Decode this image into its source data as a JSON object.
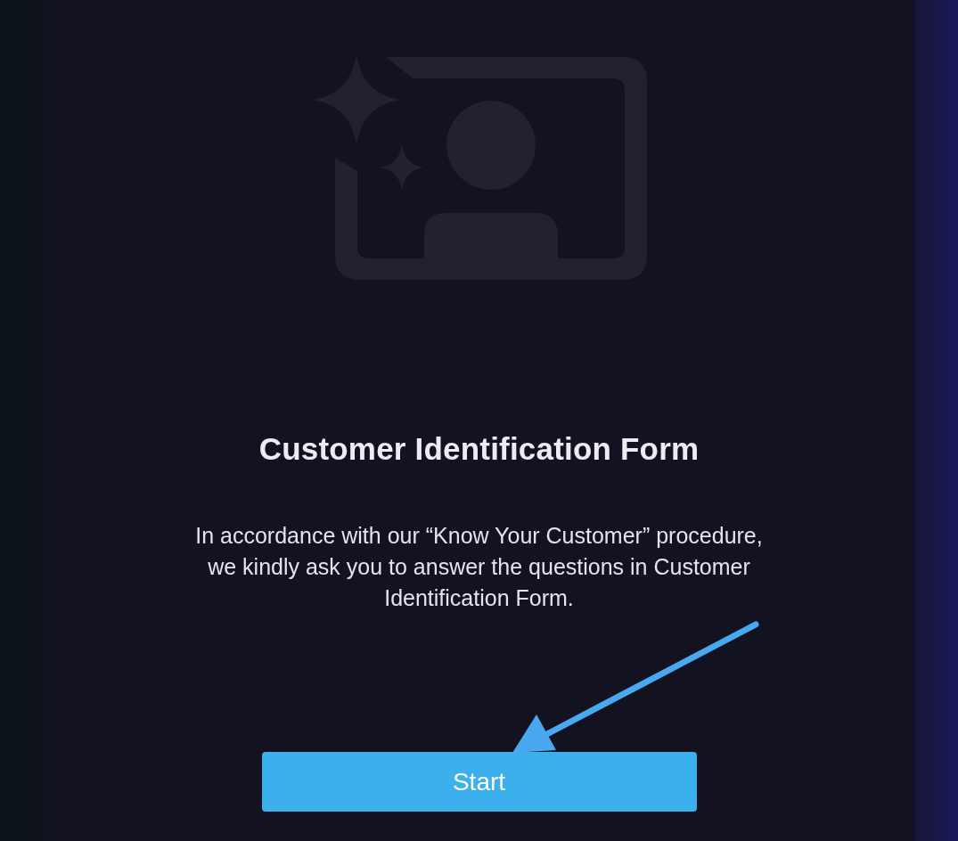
{
  "form": {
    "title": "Customer Identification Form",
    "description": "In accordance with our “Know Your Customer” procedure, we kindly ask you to answer the questions in Customer Identification Form.",
    "start_button": "Start"
  }
}
